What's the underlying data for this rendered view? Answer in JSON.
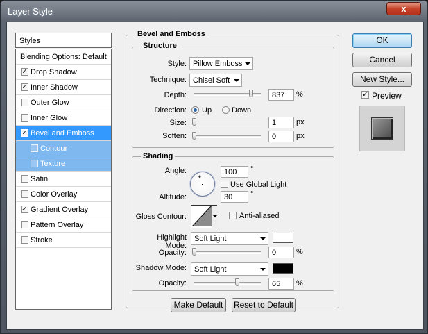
{
  "window": {
    "title": "Layer Style",
    "close_glyph": "x"
  },
  "sidebar": {
    "header": "Styles",
    "items": [
      {
        "label": "Blending Options: Default",
        "checkbox": false,
        "checked": false,
        "state": "plain"
      },
      {
        "label": "Drop Shadow",
        "checkbox": true,
        "checked": true,
        "state": "normal"
      },
      {
        "label": "Inner Shadow",
        "checkbox": true,
        "checked": true,
        "state": "normal"
      },
      {
        "label": "Outer Glow",
        "checkbox": true,
        "checked": false,
        "state": "normal"
      },
      {
        "label": "Inner Glow",
        "checkbox": true,
        "checked": false,
        "state": "normal"
      },
      {
        "label": "Bevel and Emboss",
        "checkbox": true,
        "checked": true,
        "state": "selected"
      },
      {
        "label": "Contour",
        "checkbox": true,
        "checked": false,
        "state": "sub"
      },
      {
        "label": "Texture",
        "checkbox": true,
        "checked": false,
        "state": "sub"
      },
      {
        "label": "Satin",
        "checkbox": true,
        "checked": false,
        "state": "normal"
      },
      {
        "label": "Color Overlay",
        "checkbox": true,
        "checked": false,
        "state": "normal"
      },
      {
        "label": "Gradient Overlay",
        "checkbox": true,
        "checked": true,
        "state": "normal"
      },
      {
        "label": "Pattern Overlay",
        "checkbox": true,
        "checked": false,
        "state": "normal"
      },
      {
        "label": "Stroke",
        "checkbox": true,
        "checked": false,
        "state": "normal"
      }
    ]
  },
  "bevel": {
    "group_title": "Bevel and Emboss",
    "structure": {
      "title": "Structure",
      "style_label": "Style:",
      "style_value": "Pillow Emboss",
      "technique_label": "Technique:",
      "technique_value": "Chisel Soft",
      "depth_label": "Depth:",
      "depth_value": "837",
      "depth_unit": "%",
      "depth_level": 0.85,
      "direction_label": "Direction:",
      "direction_up": "Up",
      "direction_down": "Down",
      "direction_selected": "Up",
      "size_label": "Size:",
      "size_value": "1",
      "size_unit": "px",
      "size_level": 0.0,
      "soften_label": "Soften:",
      "soften_value": "0",
      "soften_unit": "px",
      "soften_level": 0.0
    },
    "shading": {
      "title": "Shading",
      "angle_label": "Angle:",
      "angle_value": "100",
      "angle_unit": "°",
      "use_global_light_label": "Use Global Light",
      "use_global_light_checked": false,
      "altitude_label": "Altitude:",
      "altitude_value": "30",
      "altitude_unit": "°",
      "gloss_contour_label": "Gloss Contour:",
      "anti_aliased_label": "Anti-aliased",
      "anti_aliased_checked": false,
      "highlight_mode_label": "Highlight Mode:",
      "highlight_mode_value": "Soft Light",
      "highlight_color": "#ffffff",
      "highlight_opacity_label": "Opacity:",
      "highlight_opacity_value": "0",
      "highlight_opacity_unit": "%",
      "highlight_opacity_level": 0.0,
      "shadow_mode_label": "Shadow Mode:",
      "shadow_mode_value": "Soft Light",
      "shadow_color": "#000000",
      "shadow_opacity_label": "Opacity:",
      "shadow_opacity_value": "65",
      "shadow_opacity_unit": "%",
      "shadow_opacity_level": 0.65
    },
    "make_default_label": "Make Default",
    "reset_default_label": "Reset to Default"
  },
  "actions": {
    "ok_label": "OK",
    "cancel_label": "Cancel",
    "new_style_label": "New Style...",
    "preview_label": "Preview",
    "preview_checked": true
  },
  "colors": {
    "selection": "#3399ff",
    "sub_selection": "#7fb8ef"
  }
}
